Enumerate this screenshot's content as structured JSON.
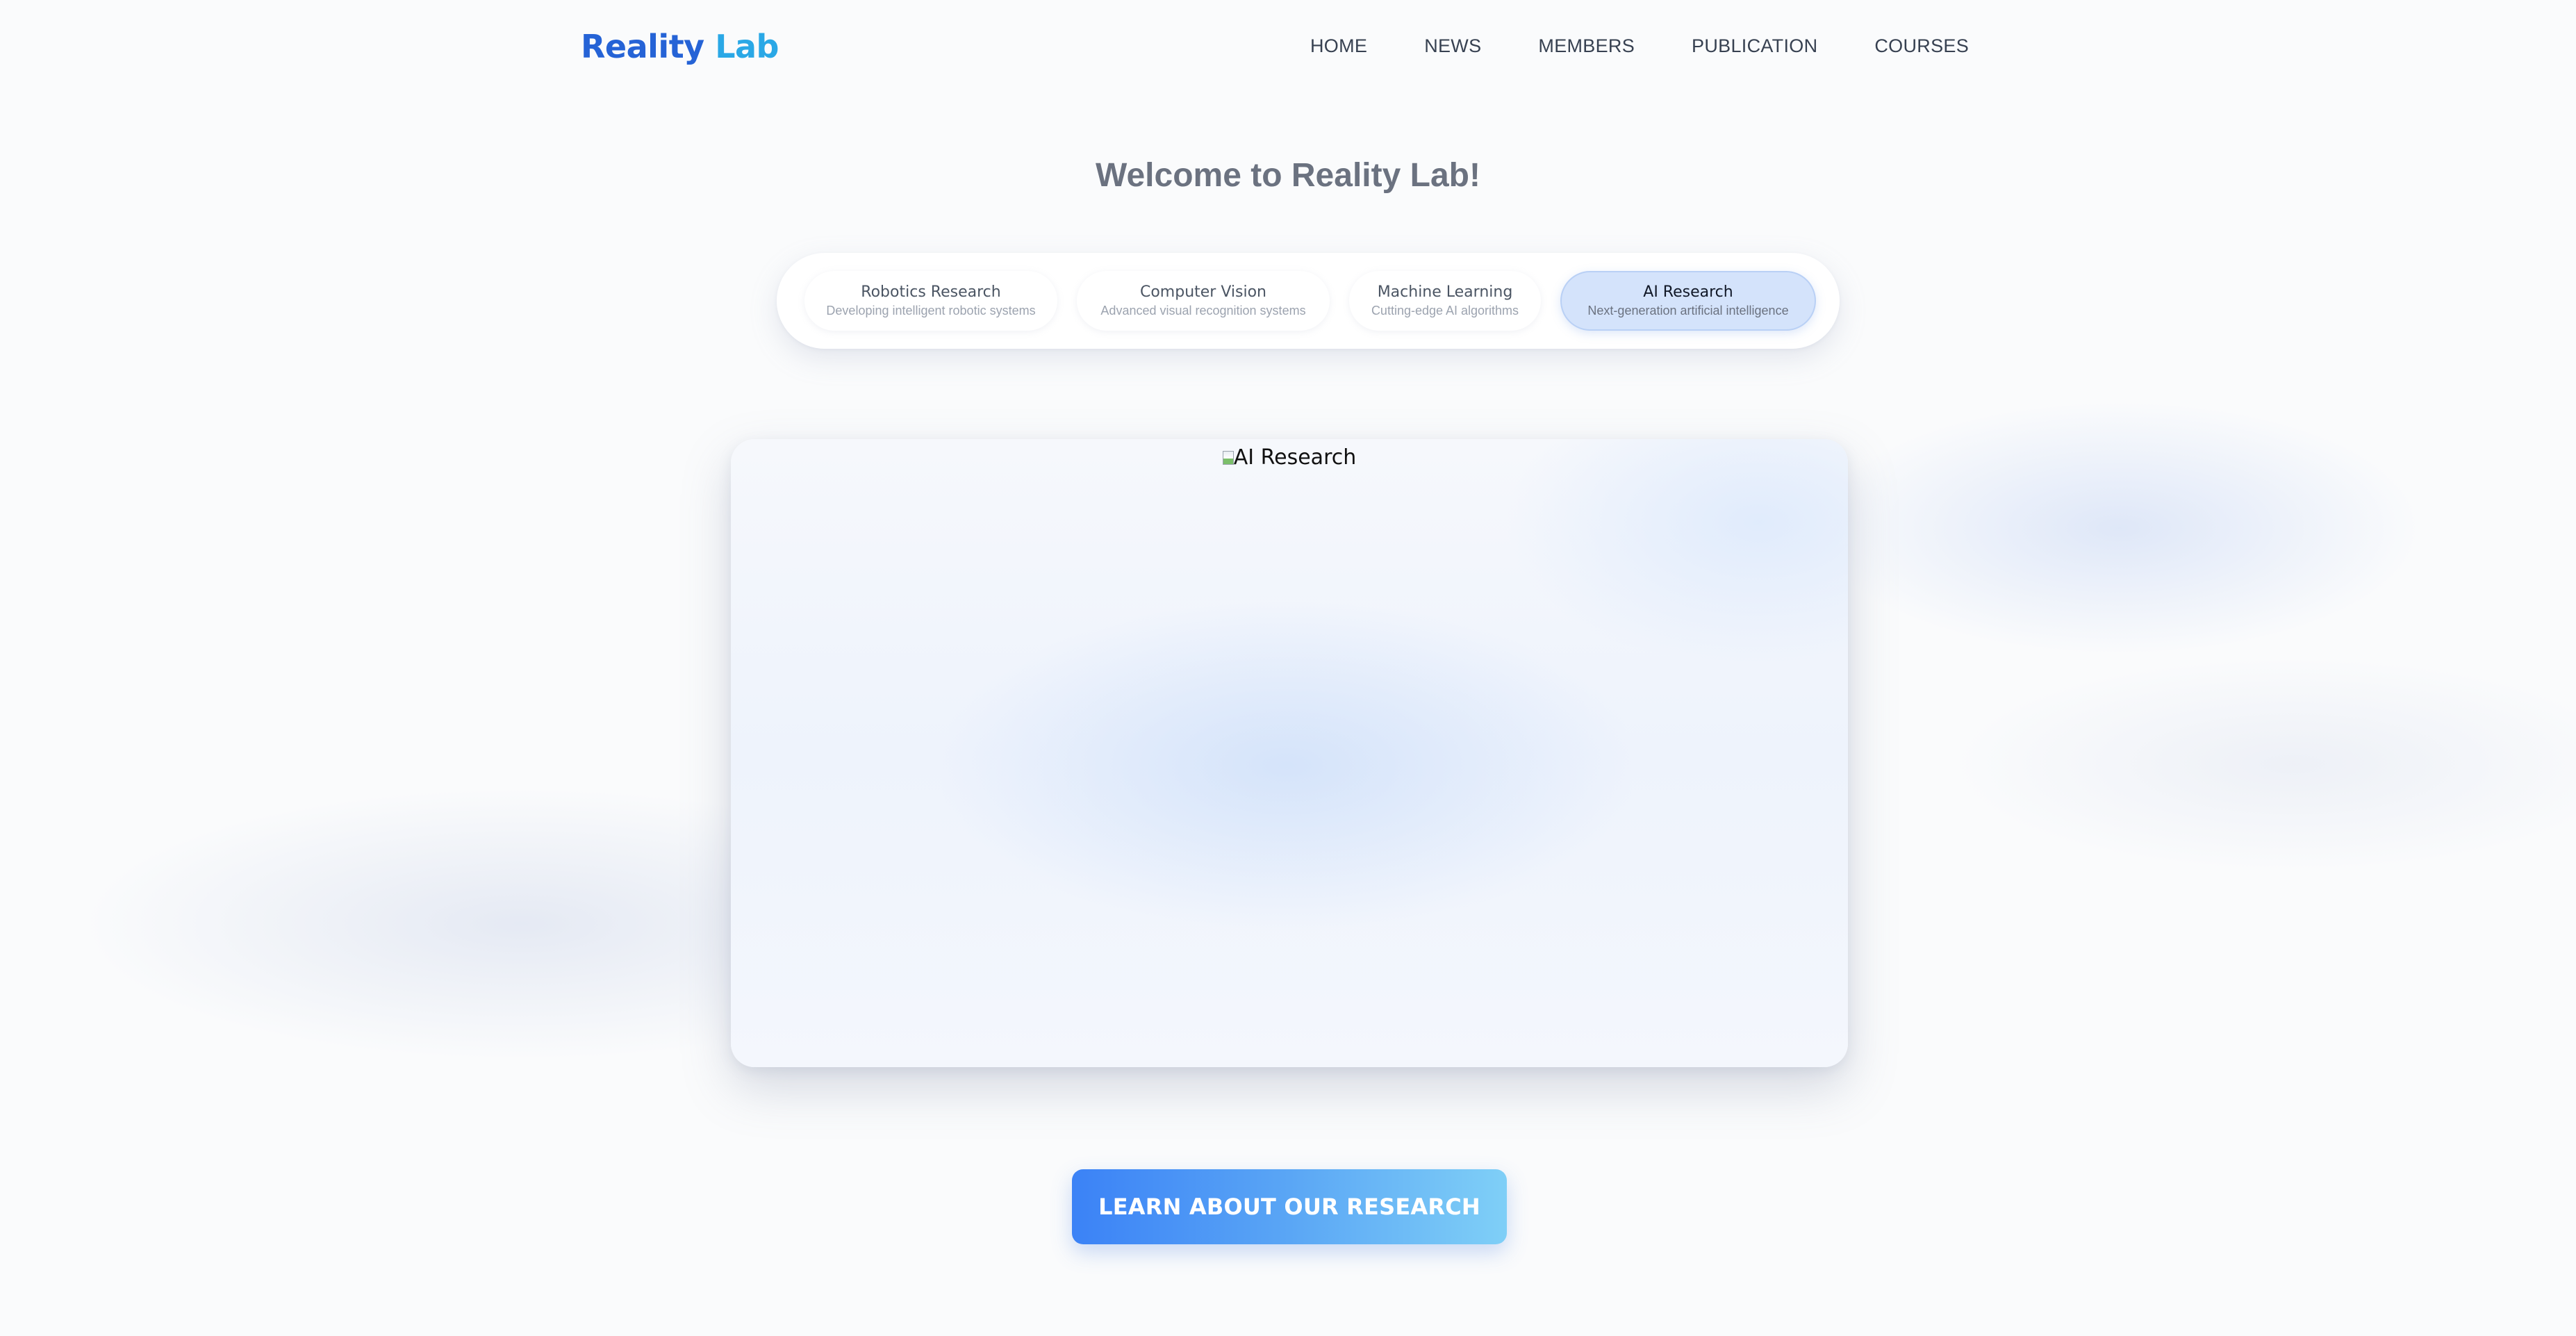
{
  "header": {
    "logo_part1": "Reality",
    "logo_part2": "Lab",
    "nav": [
      "HOME",
      "NEWS",
      "MEMBERS",
      "PUBLICATION",
      "COURSES"
    ]
  },
  "welcome": "Welcome to Reality Lab!",
  "tabs": [
    {
      "title": "Robotics Research",
      "subtitle": "Developing intelligent robotic systems",
      "active": false
    },
    {
      "title": "Computer Vision",
      "subtitle": "Advanced visual recognition systems",
      "active": false
    },
    {
      "title": "Machine Learning",
      "subtitle": "Cutting-edge AI algorithms",
      "active": false
    },
    {
      "title": "AI Research",
      "subtitle": "Next-generation artificial intelligence",
      "active": true
    }
  ],
  "main_image": {
    "alt": "AI Research",
    "icon": "broken-image-icon"
  },
  "cta": {
    "label": "LEARN ABOUT OUR RESEARCH"
  },
  "colors": {
    "logo_primary": "#2563d6",
    "logo_secondary": "#2aa8e6",
    "active_tab": "#d4e3fb",
    "cta_gradient_start": "#3b82f6",
    "cta_gradient_end": "#7fcff7"
  }
}
